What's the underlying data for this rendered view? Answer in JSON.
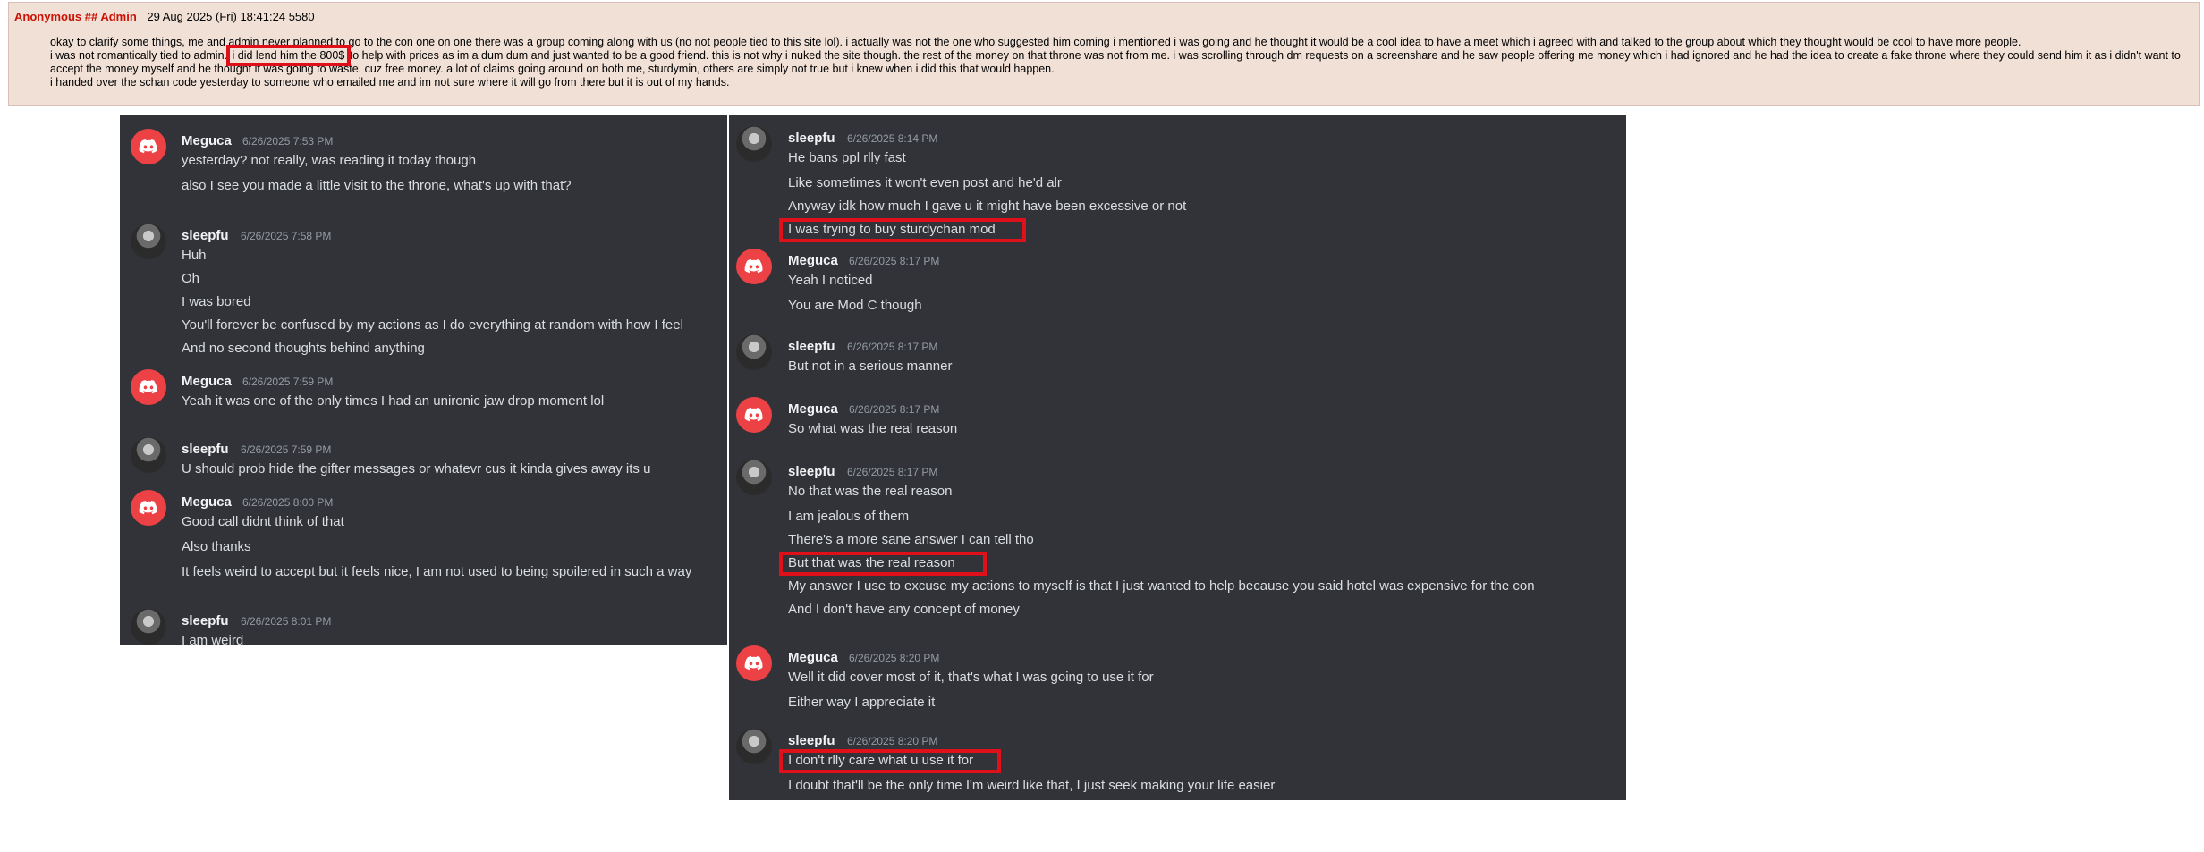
{
  "post": {
    "name": "Anonymous ## Admin",
    "date": "29 Aug 2025 (Fri) 18:41:24",
    "number": "5580",
    "body": [
      "okay to clarify some things, me and admin never planned to go to the con one on one there was a group coming along with us (no not people tied to this site lol). i actually was not the one who suggested him coming i mentioned i was going and he thought it would be a cool idea to have a meet which i agreed with and talked to the group about which they thought would be cool to have more people.",
      "i was not romantically tied to admin.",
      "i did lend him the 800$",
      "to help with prices as im a dum dum and just wanted to be a good friend. this is not why i nuked the site though. the rest of the money on that throne was not from me. i was scrolling through dm requests on a screenshare and he saw people offering me money which i had ignored and he had the idea to create a fake throne where they could send him it as i didn't want to accept the money myself and he thought it was going to waste. cuz free money. a lot of claims going around on both me, sturdymin, others are simply not true but i knew when i did this that would happen.",
      "i handed over the schan code yesterday to someone who emailed me and im not sure where it will go from there but it is out of my hands."
    ]
  },
  "chat_left": [
    {
      "author": "Meguca",
      "avatar": "discord-logo-icon",
      "time": "6/26/2025 7:53 PM",
      "lines": [
        "yesterday? not really, was reading it today though",
        "also I see you made a little visit to the throne, what's up with that?"
      ]
    },
    {
      "author": "sleepfu",
      "avatar": "anime-avatar",
      "time": "6/26/2025 7:58 PM",
      "lines": [
        "Huh",
        "Oh",
        "I was bored",
        "You'll forever be confused by my actions as I do everything at random with how I feel",
        "And no second thoughts behind anything"
      ]
    },
    {
      "author": "Meguca",
      "avatar": "discord-logo-icon",
      "time": "6/26/2025 7:59 PM",
      "lines": [
        "Yeah it was one of the only times I had an unironic jaw drop moment lol"
      ]
    },
    {
      "author": "sleepfu",
      "avatar": "anime-avatar",
      "time": "6/26/2025 7:59 PM",
      "lines": [
        "U should prob hide the gifter messages or whatevr cus it kinda gives away its u"
      ]
    },
    {
      "author": "Meguca",
      "avatar": "discord-logo-icon",
      "time": "6/26/2025 8:00 PM",
      "lines": [
        "Good call didnt think of that",
        "Also thanks",
        "It feels weird to accept but it feels nice, I am not used to being spoilered in such a way"
      ]
    },
    {
      "author": "sleepfu",
      "avatar": "anime-avatar",
      "time": "6/26/2025 8:01 PM",
      "lines": [
        "I am weird"
      ]
    }
  ],
  "chat_right": [
    {
      "author": "sleepfu",
      "avatar": "anime-avatar",
      "time": "6/26/2025 8:14 PM",
      "lines": [
        "He bans ppl rlly fast",
        "Like sometimes it won't even post and he'd alr",
        "Anyway idk how much I gave u it might have been excessive or not",
        "I was trying to buy sturdychan mod"
      ]
    },
    {
      "author": "Meguca",
      "avatar": "discord-logo-icon",
      "time": "6/26/2025 8:17 PM",
      "lines": [
        "Yeah I noticed",
        "You are Mod C though"
      ]
    },
    {
      "author": "sleepfu",
      "avatar": "anime-avatar",
      "time": "6/26/2025 8:17 PM",
      "lines": [
        "But not in a serious manner"
      ]
    },
    {
      "author": "Meguca",
      "avatar": "discord-logo-icon",
      "time": "6/26/2025 8:17 PM",
      "lines": [
        "So what was the real reason"
      ]
    },
    {
      "author": "sleepfu",
      "avatar": "anime-avatar",
      "time": "6/26/2025 8:17 PM",
      "lines": [
        "No that was the real reason",
        "I am jealous of them",
        "There's a more sane answer I can tell tho",
        "But that was the real reason",
        "My answer I use to excuse my actions to myself is that I just wanted to help because you said hotel was expensive for the con",
        "And I don't have any concept of money"
      ]
    },
    {
      "author": "Meguca",
      "avatar": "discord-logo-icon",
      "time": "6/26/2025 8:20 PM",
      "lines": [
        "Well it did cover most of it, that's what I was going to use it for",
        "Either way I appreciate it"
      ]
    },
    {
      "author": "sleepfu",
      "avatar": "anime-avatar",
      "time": "6/26/2025 8:20 PM",
      "lines": [
        "I don't rlly care what u use it for",
        "I doubt that'll be the only time I'm weird like that, I just seek making your life easier"
      ]
    }
  ],
  "colors": {
    "post_bg": "#f0e0d6",
    "post_name": "#cc1105",
    "discord_bg": "#313338",
    "meguca_avatar": "#ed4245",
    "highlight": "#e0101b"
  }
}
